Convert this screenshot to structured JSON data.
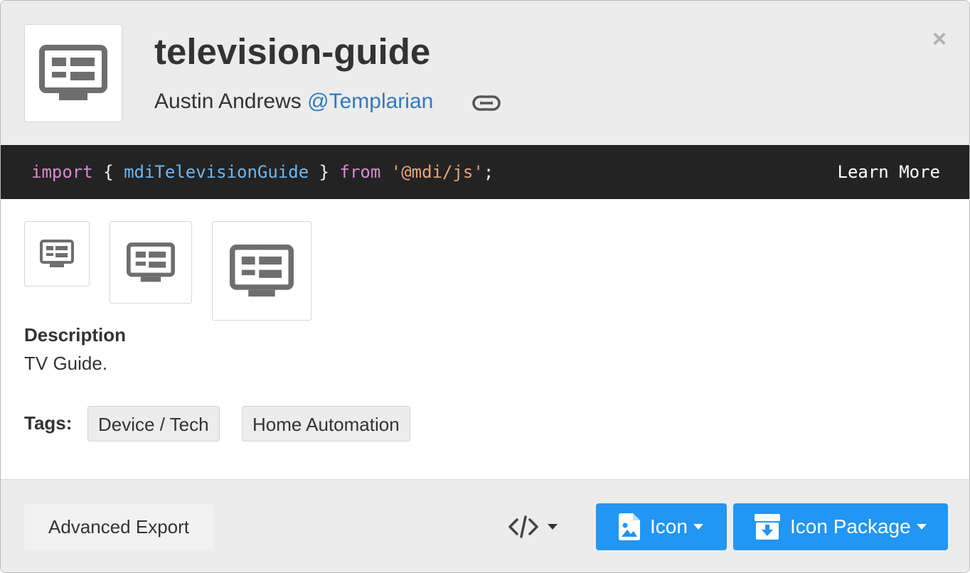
{
  "icon": {
    "title": "television-guide",
    "author": "Austin Andrews",
    "handle": "@Templarian"
  },
  "code": {
    "import": "import",
    "brace_open": "{",
    "name": "mdiTelevisionGuide",
    "brace_close": "}",
    "from": "from",
    "module": "'@mdi/js'",
    "semicolon": ";",
    "learn_more": "Learn More"
  },
  "description": {
    "label": "Description",
    "text": "TV Guide."
  },
  "tags": {
    "label": "Tags:",
    "items": [
      "Device / Tech",
      "Home Automation"
    ]
  },
  "footer": {
    "advanced_export": "Advanced Export",
    "icon_button": "Icon",
    "package_button": "Icon Package"
  },
  "colors": {
    "accent": "#2196f3",
    "header_bg": "#ececec",
    "code_bg": "#232323",
    "icon_gray": "#6e6e6e",
    "link_blue": "#2f7bc1"
  },
  "icons": [
    "television-guide-icon",
    "link-icon",
    "close-icon",
    "code-icon",
    "image-file-icon",
    "package-download-icon",
    "caret-down-icon"
  ]
}
